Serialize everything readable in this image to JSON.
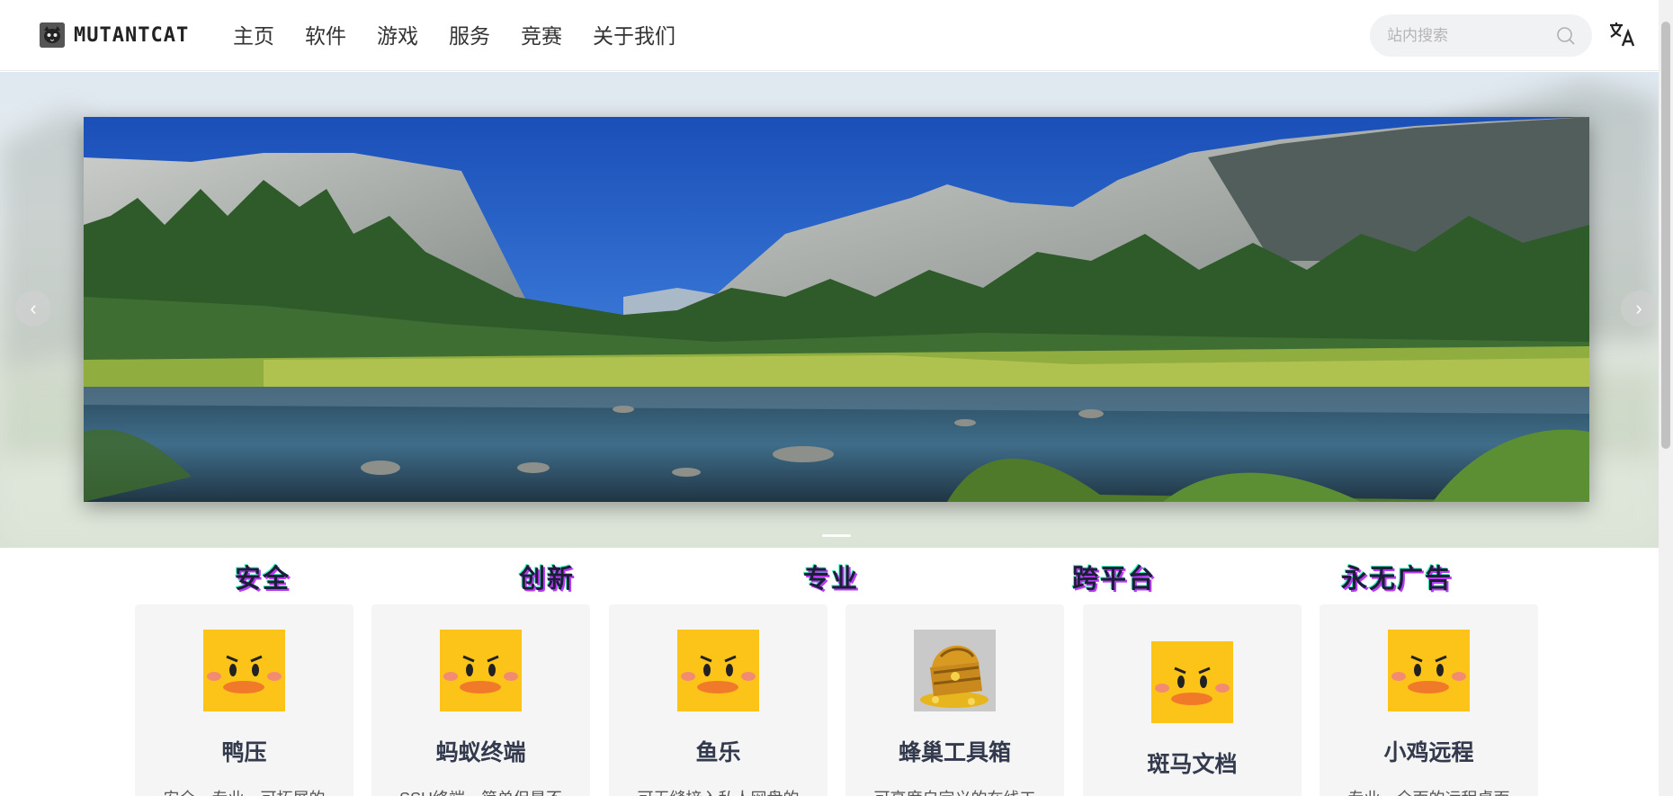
{
  "header": {
    "logo_text": "MUTANTCAT",
    "nav": [
      "主页",
      "软件",
      "游戏",
      "服务",
      "竞赛",
      "关于我们"
    ],
    "search_placeholder": "站内搜索"
  },
  "hero": {
    "prev_label": "‹",
    "next_label": "›"
  },
  "features": {
    "titles": [
      "安全",
      "创新",
      "专业",
      "跨平台",
      "永无广告"
    ]
  },
  "cards": [
    {
      "name": "鸭压",
      "desc": "安全、专业、可拓展的",
      "icon": "duck-icon"
    },
    {
      "name": "蚂蚁终端",
      "desc": "SSH终端，简单但是不",
      "icon": "duck-icon"
    },
    {
      "name": "鱼乐",
      "desc": "可无缝接入私人网盘的",
      "icon": "duck-icon"
    },
    {
      "name": "蜂巢工具箱",
      "desc": "可高度自定义的在线工",
      "icon": "treasure-chest-icon"
    },
    {
      "name": "斑马文档",
      "desc": "",
      "icon": "duck-icon"
    },
    {
      "name": "小鸡远程",
      "desc": "专业、全面的远程桌面",
      "icon": "duck-icon"
    }
  ]
}
